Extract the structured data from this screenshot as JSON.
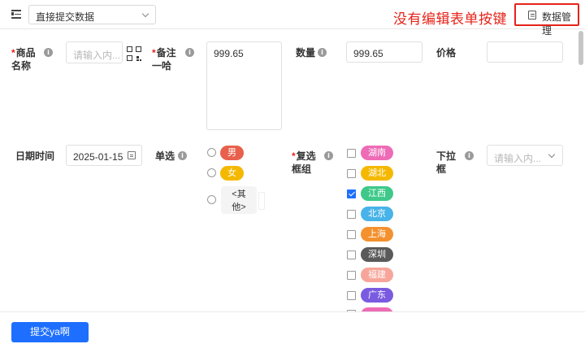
{
  "header": {
    "form_select": {
      "value": "直接提交数据"
    },
    "notice": "没有编辑表单按键",
    "data_mgmt_label": "数据管理",
    "notice_color": "#e5231a"
  },
  "fields": {
    "product_name": {
      "label_line1": "商品",
      "label_line2": "名称",
      "required": true,
      "placeholder": "请输入内..."
    },
    "remark": {
      "label_line1": "备注",
      "label_line2": "一哈",
      "required": true,
      "value": "999.65"
    },
    "quantity": {
      "label": "数量",
      "value": "999.65"
    },
    "price": {
      "label": "价格",
      "value": ""
    },
    "datetime": {
      "label": "日期时间",
      "value": "2025-01-15"
    },
    "radio": {
      "label": "单选",
      "options": [
        {
          "label": "男",
          "color": "#e8604c"
        },
        {
          "label": "女",
          "color": "#f5b800"
        },
        {
          "label_line1": "<其",
          "label_line2": "他>"
        }
      ]
    },
    "checkbox_group": {
      "label_line1": "复选",
      "label_line2": "框组",
      "required": true,
      "options": [
        {
          "label": "湖南",
          "color": "#ee6bb6",
          "checked": false
        },
        {
          "label": "湖北",
          "color": "#f5b800",
          "checked": false
        },
        {
          "label": "江西",
          "color": "#3ec98a",
          "checked": true
        },
        {
          "label": "北京",
          "color": "#47b3e8",
          "checked": false
        },
        {
          "label": "上海",
          "color": "#f4912f",
          "checked": false
        },
        {
          "label": "深圳",
          "color": "#5a5a5a",
          "checked": false
        },
        {
          "label": "福建",
          "color": "#f7a59a",
          "checked": false
        },
        {
          "label": "广东",
          "color": "#7a5be0",
          "checked": false
        }
      ]
    },
    "dropdown": {
      "label_line1": "下拉",
      "label_line2": "框",
      "placeholder": "请输入内..."
    }
  },
  "footer": {
    "submit_label": "提交ya啊",
    "accent": "#1e6fff"
  }
}
